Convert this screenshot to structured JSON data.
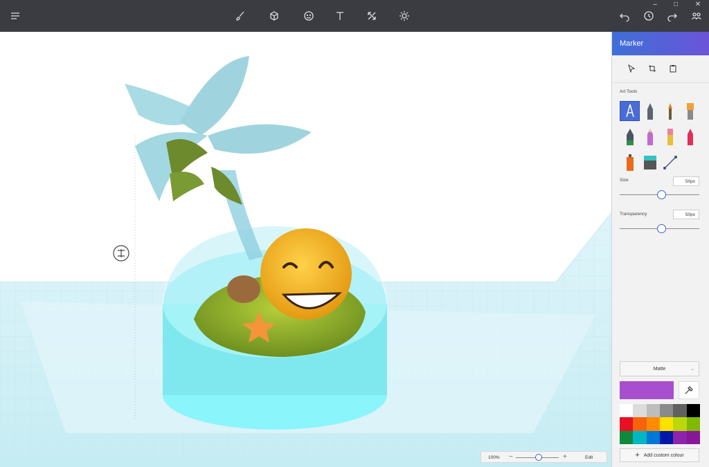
{
  "toolbar": {
    "menu_icon": "hamburger-icon",
    "tools": [
      "brush-icon",
      "3d-cube-icon",
      "sticker-icon",
      "text-icon",
      "canvas-resize-icon",
      "effects-sun-icon"
    ],
    "right": [
      "undo-icon",
      "history-icon",
      "redo-icon",
      "community-icon"
    ],
    "window_controls": [
      "–",
      "□",
      "✕"
    ]
  },
  "panel": {
    "title": "Marker",
    "select_tools": [
      "select-icon",
      "crop-icon",
      "paste-icon"
    ],
    "art_tools_label": "Art Tools",
    "art_tools": [
      "marker",
      "calligraphy-pen",
      "oil-brush",
      "watercolor",
      "pen",
      "pencil",
      "eraser",
      "crayon",
      "spray-can",
      "fill",
      "line"
    ],
    "size_label": "Size",
    "size_value": "50px",
    "size_level": 0.53,
    "transparency_label": "Transparency",
    "transparency_value": "50px",
    "transparency_level": 0.53,
    "finish": "Matte",
    "current_color": "#a74fce",
    "palette": [
      "#ffffff",
      "#dcdcdc",
      "#bdbdbd",
      "#8a8a8a",
      "#606060",
      "#000000",
      "#e81123",
      "#f7630c",
      "#ff8c00",
      "#fce100",
      "#bad80a",
      "#7fba00",
      "#10893e",
      "#00b7c3",
      "#0078d7",
      "#0018a8",
      "#8e24aa",
      "#881798"
    ],
    "add_color_label": "Add custom colour"
  },
  "zoom": {
    "percent": "100%",
    "minus": "−",
    "plus": "+",
    "edit_label": "Edit",
    "level": 0.53
  },
  "colors": {
    "topbar": "#3a3c42",
    "accent": "#4a6cd6",
    "base": "#7fe8ee",
    "grid": "#cfeff6"
  }
}
